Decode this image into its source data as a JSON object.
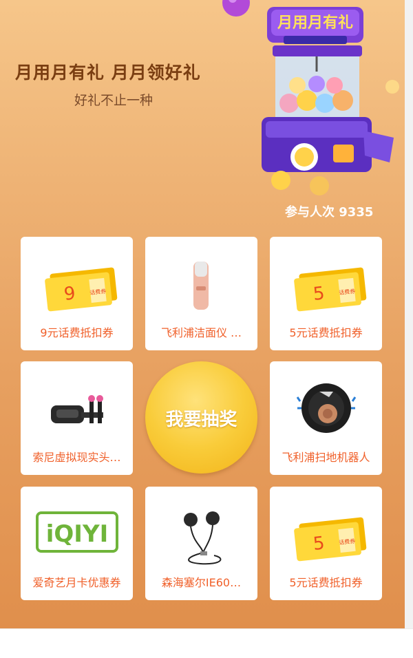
{
  "banner": {
    "headline": "月用月有礼 月月领好礼",
    "subline": "好礼不止一种",
    "machine_title": "月用月有礼",
    "participants": "参与人次 9335"
  },
  "draw_button": {
    "label": "我要抽奖"
  },
  "prizes": [
    {
      "label": "9元话费抵扣券",
      "icon": "coupon-icon",
      "value": "9",
      "coupon_text": "话费券"
    },
    {
      "label": "飞利浦洁面仪 …",
      "icon": "face-cleanser-icon"
    },
    {
      "label": "5元话费抵扣券",
      "icon": "coupon-icon",
      "value": "5",
      "coupon_text": "话费券"
    },
    {
      "label": "索尼虚拟现实头…",
      "icon": "vr-headset-icon"
    },
    {
      "label": "飞利浦扫地机器人",
      "icon": "robot-vacuum-icon"
    },
    {
      "label": "爱奇艺月卡优惠券",
      "icon": "iqiyi-logo",
      "logo_text": "iQIYI"
    },
    {
      "label": "森海塞尔IE60…",
      "icon": "earphones-icon"
    },
    {
      "label": "5元话费抵扣券",
      "icon": "coupon-icon",
      "value": "5",
      "coupon_text": "话费券"
    }
  ],
  "colors": {
    "accent": "#f0602a",
    "banner_text": "#7a3e12",
    "draw_button": "#f9cc3a"
  }
}
